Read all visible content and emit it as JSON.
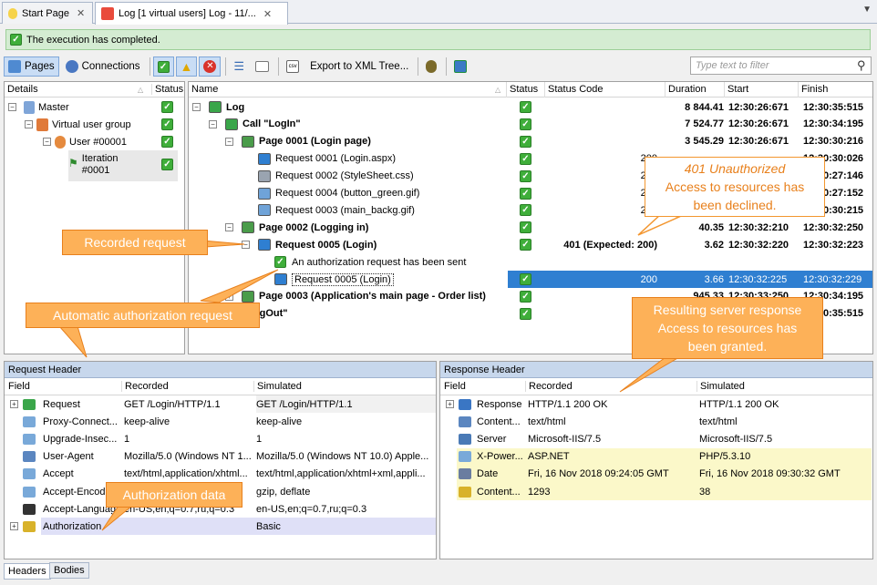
{
  "tabs": {
    "start": "Start Page",
    "log": "Log [1 virtual users] Log - 11/..."
  },
  "status_message": "The execution has completed.",
  "toolbar": {
    "pages": "Pages",
    "connections": "Connections",
    "export": "Export to XML Tree...",
    "filter_placeholder": "Type text to filter"
  },
  "details": {
    "col_details": "Details",
    "col_status": "Status",
    "items": [
      {
        "label": "Master"
      },
      {
        "label": "Virtual user group"
      },
      {
        "label": "User #00001"
      },
      {
        "label": "Iteration #0001"
      }
    ]
  },
  "log": {
    "cols": {
      "name": "Name",
      "status": "Status",
      "code": "Status Code",
      "duration": "Duration",
      "start": "Start",
      "finish": "Finish"
    },
    "rows": [
      {
        "name": "Log",
        "code": "",
        "duration": "8 844.41",
        "start": "12:30:26:671",
        "finish": "12:30:35:515"
      },
      {
        "name": "Call \"LogIn\"",
        "code": "",
        "duration": "7 524.77",
        "start": "12:30:26:671",
        "finish": "12:30:34:195"
      },
      {
        "name": "Page 0001 (Login page)",
        "code": "",
        "duration": "3 545.29",
        "start": "12:30:26:671",
        "finish": "12:30:30:216"
      },
      {
        "name": "Request 0001 (Login.aspx)",
        "code": "200",
        "duration": "",
        "start": "",
        "finish": "12:30:30:026"
      },
      {
        "name": "Request 0002 (StyleSheet.css)",
        "code": "200",
        "duration": "",
        "start": "",
        "finish": "12:30:27:146"
      },
      {
        "name": "Request 0004 (button_green.gif)",
        "code": "200",
        "duration": "",
        "start": "",
        "finish": "12:30:27:152"
      },
      {
        "name": "Request 0003 (main_backg.gif)",
        "code": "200",
        "duration": "",
        "start": "",
        "finish": "12:30:30:215"
      },
      {
        "name": "Page 0002 (Logging in)",
        "code": "",
        "duration": "40.35",
        "start": "12:30:32:210",
        "finish": "12:30:32:250"
      },
      {
        "name": "Request 0005 (Login)",
        "code": "401 (Expected: 200)",
        "duration": "3.62",
        "start": "12:30:32:220",
        "finish": "12:30:32:223"
      },
      {
        "name": "An authorization request has been sent",
        "code": "",
        "duration": "",
        "start": "",
        "finish": ""
      },
      {
        "name": "Request 0005 (Login)",
        "code": "200",
        "duration": "3.66",
        "start": "12:30:32:225",
        "finish": "12:30:32:229"
      },
      {
        "name": "Page 0003 (Application's main page - Order list)",
        "code": "",
        "duration": "945.33",
        "start": "12:30:33:250",
        "finish": "12:30:34:195"
      },
      {
        "name": "\"LogOut\"",
        "code": "",
        "duration": "",
        "start": "",
        "finish": "12:30:35:515"
      }
    ]
  },
  "request_header": {
    "title": "Request Header",
    "cols": {
      "field": "Field",
      "recorded": "Recorded",
      "simulated": "Simulated"
    },
    "rows": [
      {
        "field": "Request",
        "recorded": "GET /Login/HTTP/1.1",
        "simulated": "GET /Login/HTTP/1.1"
      },
      {
        "field": "Proxy-Connect...",
        "recorded": "keep-alive",
        "simulated": "keep-alive"
      },
      {
        "field": "Upgrade-Insec...",
        "recorded": "1",
        "simulated": "1"
      },
      {
        "field": "User-Agent",
        "recorded": "Mozilla/5.0 (Windows NT 1...",
        "simulated": "Mozilla/5.0 (Windows NT 10.0) Apple..."
      },
      {
        "field": "Accept",
        "recorded": "text/html,application/xhtml...",
        "simulated": "text/html,application/xhtml+xml,appli..."
      },
      {
        "field": "Accept-Encodin",
        "recorded": "",
        "simulated": "gzip, deflate"
      },
      {
        "field": "Accept-Language",
        "recorded": "en-US,en;q=0.7,ru;q=0.3",
        "simulated": "en-US,en;q=0.7,ru;q=0.3"
      },
      {
        "field": "Authorization",
        "recorded": "",
        "simulated": "Basic"
      }
    ]
  },
  "response_header": {
    "title": "Response Header",
    "cols": {
      "field": "Field",
      "recorded": "Recorded",
      "simulated": "Simulated"
    },
    "rows": [
      {
        "field": "Response",
        "recorded": "HTTP/1.1 200 OK",
        "simulated": "HTTP/1.1 200 OK"
      },
      {
        "field": "Content...",
        "recorded": "text/html",
        "simulated": "text/html"
      },
      {
        "field": "Server",
        "recorded": "Microsoft-IIS/7.5",
        "simulated": "Microsoft-IIS/7.5"
      },
      {
        "field": "X-Power...",
        "recorded": "ASP.NET",
        "simulated": "PHP/5.3.10"
      },
      {
        "field": "Date",
        "recorded": "Fri, 16 Nov 2018 09:24:05 GMT",
        "simulated": "Fri, 16 Nov 2018 09:30:32 GMT"
      },
      {
        "field": "Content...",
        "recorded": "1293",
        "simulated": "38"
      }
    ]
  },
  "bottom_tabs": {
    "headers": "Headers",
    "bodies": "Bodies"
  },
  "callouts": {
    "unauthorized_title": "401 Unauthorized",
    "unauthorized_text": "Access to resources has been declined.",
    "recorded": "Recorded request",
    "auto_auth": "Automatic authorization request",
    "resulting_title": "Resulting server response",
    "resulting_text": "Access to resources has been granted.",
    "auth_data": "Authorization data"
  }
}
